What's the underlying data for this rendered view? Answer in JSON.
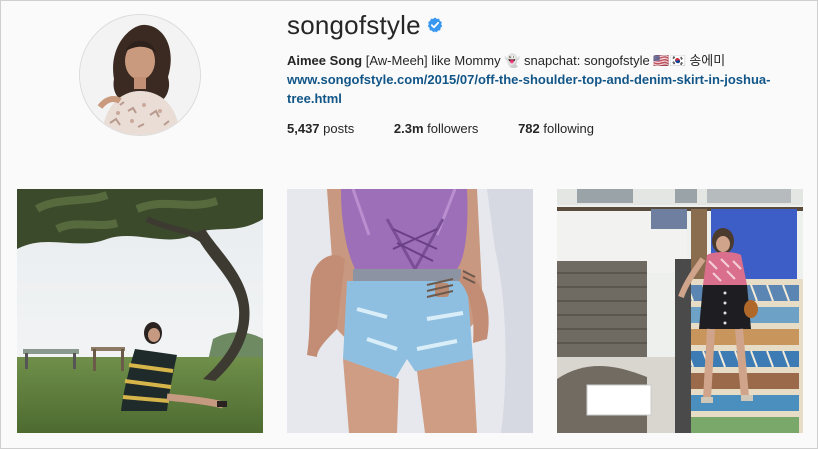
{
  "profile": {
    "username": "songofstyle",
    "verified_icon": "verified-badge-icon",
    "full_name": "Aimee Song",
    "bio_text": "[Aw-Meeh] like Mommy 👻 snapchat: songofstyle 🇺🇸🇰🇷 송에미",
    "website": "www.songofstyle.com/2015/07/off-the-shoulder-top-and-denim-skirt-in-joshua-tree.html"
  },
  "stats": {
    "posts_count": "5,437",
    "posts_label": "posts",
    "followers_count": "2.3m",
    "followers_label": "followers",
    "following_count": "782",
    "following_label": "following"
  },
  "posts": [
    {
      "subject": "woman in striped dress sitting under tree on grass"
    },
    {
      "subject": "purple lace-up swimsuit with denim shorts"
    },
    {
      "subject": "woman in pink top and black skirt on tiled stairs"
    }
  ],
  "colors": {
    "link": "#125688",
    "verified": "#3897f0",
    "text": "#262626"
  }
}
